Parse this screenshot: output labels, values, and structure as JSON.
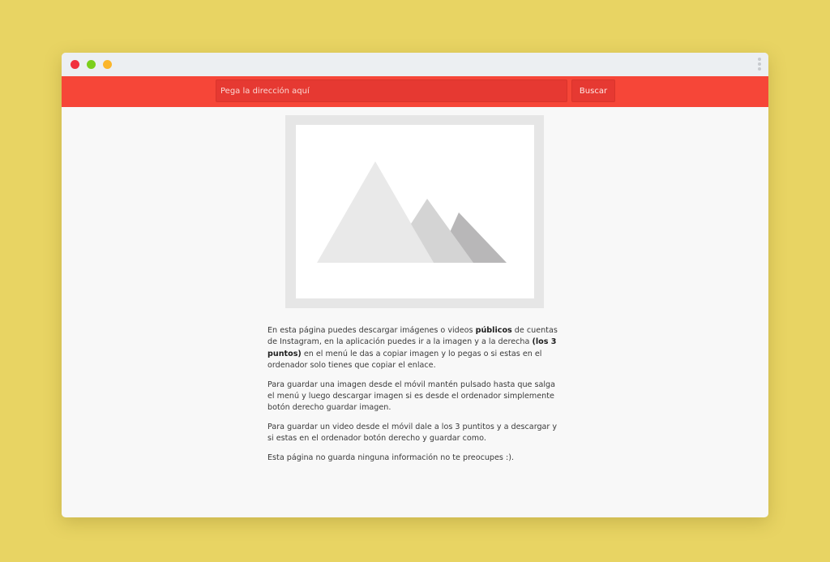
{
  "search": {
    "placeholder": "Pega la dirección aquí",
    "button_label": "Buscar"
  },
  "preview_icon": "image-placeholder-icon",
  "colors": {
    "background": "#e8d463",
    "toolbar": "#f64638",
    "input": "#e63932",
    "close_dot": "#f1303d",
    "maximize_dot": "#7bcf1c",
    "minimize_dot": "#fbb62b"
  },
  "content": {
    "p1": {
      "part1": "En esta página puedes descargar imágenes o videos ",
      "bold1": "públicos",
      "part2": " de cuentas de Instagram, en la aplicación puedes ir a la imagen y a la derecha ",
      "bold2": "(los 3 puntos)",
      "part3": " en el menú le das a copiar imagen y lo pegas o si estas en el ordenador solo tienes que copiar el enlace."
    },
    "p2": "Para guardar una imagen desde el móvil mantén pulsado hasta que salga el menú y luego descargar imagen si es desde el ordenador simplemente botón derecho guardar imagen.",
    "p3": "Para guardar un video desde el móvil dale a los 3 puntitos y a descargar y si estas en el ordenador botón derecho y guardar como.",
    "p4": "Esta página no guarda ninguna información no te preocupes :)."
  }
}
